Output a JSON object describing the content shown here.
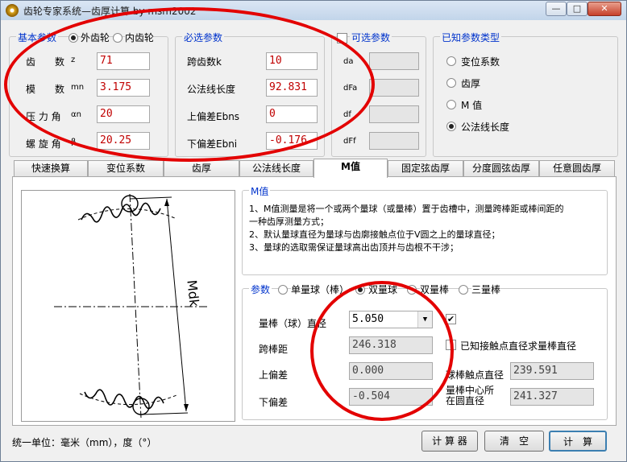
{
  "window": {
    "title": "齿轮专家系统—齿厚计算 by msm2002",
    "min": "—",
    "max": "□",
    "close": "✕"
  },
  "basic": {
    "legend": "基本参数",
    "ext_label": "外齿轮",
    "int_label": "内齿轮",
    "rows": [
      {
        "label": "齿　　数",
        "sym": "z",
        "value": "71"
      },
      {
        "label": "模　　数",
        "sym": "mn",
        "value": "3.175"
      },
      {
        "label": "压 力 角",
        "sym": "αn",
        "value": "20"
      },
      {
        "label": "螺 旋 角",
        "sym": "β",
        "value": "20.25"
      }
    ]
  },
  "required": {
    "legend": "必选参数",
    "rows": [
      {
        "label": "跨齿数k",
        "value": "10"
      },
      {
        "label": "公法线长度",
        "value": "92.831"
      },
      {
        "label": "上偏差Ebns",
        "value": "0"
      },
      {
        "label": "下偏差Ebni",
        "value": "-0.176"
      }
    ]
  },
  "optional": {
    "legend": "可选参数",
    "rows": [
      {
        "label": "da"
      },
      {
        "label": "dFa"
      },
      {
        "label": "df"
      },
      {
        "label": "dFf"
      }
    ]
  },
  "known_type": {
    "legend": "已知参数类型",
    "options": [
      "变位系数",
      "齿厚",
      "M 值",
      "公法线长度"
    ],
    "selected": 3
  },
  "tabs": [
    "快速换算",
    "变位系数",
    "齿厚",
    "公法线长度",
    "M值",
    "固定弦齿厚",
    "分度圆弦齿厚",
    "任意圆齿厚"
  ],
  "active_tab": 4,
  "mvalue": {
    "desc_title": "M值",
    "desc_lines": [
      "1、M值测量是将一个或两个量球（或量棒）置于齿槽中，测量跨棒距或棒间距的",
      "   一种齿厚测量方式；",
      "2、默认量球直径为量球与齿廓接触点位于V圆之上的量球直径；",
      "3、量球的选取需保证量球高出齿顶并与齿根不干涉；"
    ],
    "diagram_label": "Mdk",
    "params_legend": "参数",
    "ball_modes": [
      "单量球（棒）",
      "双量球",
      "双量棒",
      "三量棒"
    ],
    "ball_selected": 1,
    "rows": [
      {
        "label": "量棒（球）直径",
        "value": "5.050"
      },
      {
        "label": "跨棒距",
        "value": "246.318"
      },
      {
        "label": "上偏差",
        "value": "0.000"
      },
      {
        "label": "下偏差",
        "value": "-0.504"
      }
    ],
    "check_label": "已知接触点直径求量棒直径",
    "contact_label": "球棒触点直径",
    "contact_value": "239.591",
    "center_label_1": "量棒中心所",
    "center_label_2": "在圆直径",
    "center_value": "241.327"
  },
  "footer": {
    "units": "统一单位：毫米（mm），度（°）",
    "calc_btn": "计 算 器",
    "clear_btn": "清　空",
    "compute_btn": "计　算"
  },
  "colors": {
    "legend": "#0033cc",
    "value_text": "#c00000",
    "annotation": "#e30000"
  }
}
